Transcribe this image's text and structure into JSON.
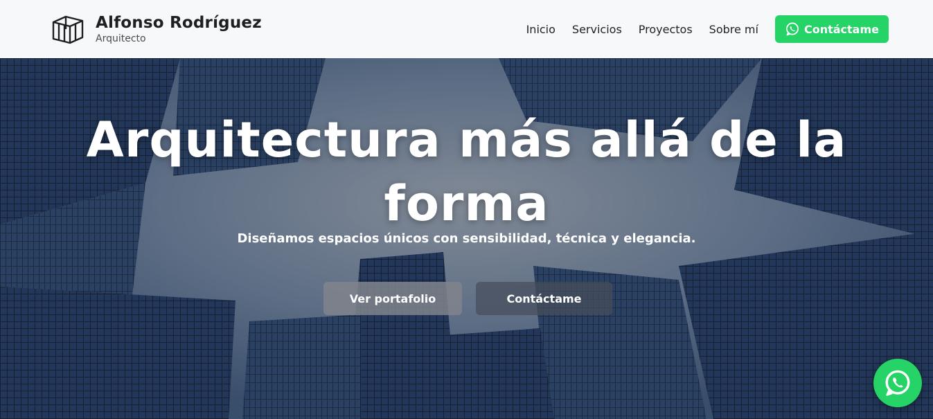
{
  "brand": {
    "name": "Alfonso Rodríguez",
    "role": "Arquitecto",
    "logo_icon": "building-outline-icon"
  },
  "nav": {
    "items": [
      {
        "label": "Inicio"
      },
      {
        "label": "Servicios"
      },
      {
        "label": "Proyectos"
      },
      {
        "label": "Sobre mí"
      }
    ],
    "cta_label": "Contáctame",
    "cta_icon": "whatsapp-icon",
    "cta_color": "#25d366"
  },
  "hero": {
    "title": "Arquitectura más allá de la forma",
    "subtitle": "Diseñamos espacios únicos con sensibilidad, técnica y elegancia.",
    "primary_button": "Ver portafolio",
    "secondary_button": "Contáctame",
    "background": "skyscrapers-looking-up-photo"
  },
  "floating_button": {
    "icon": "whatsapp-icon",
    "color": "#25d366"
  }
}
